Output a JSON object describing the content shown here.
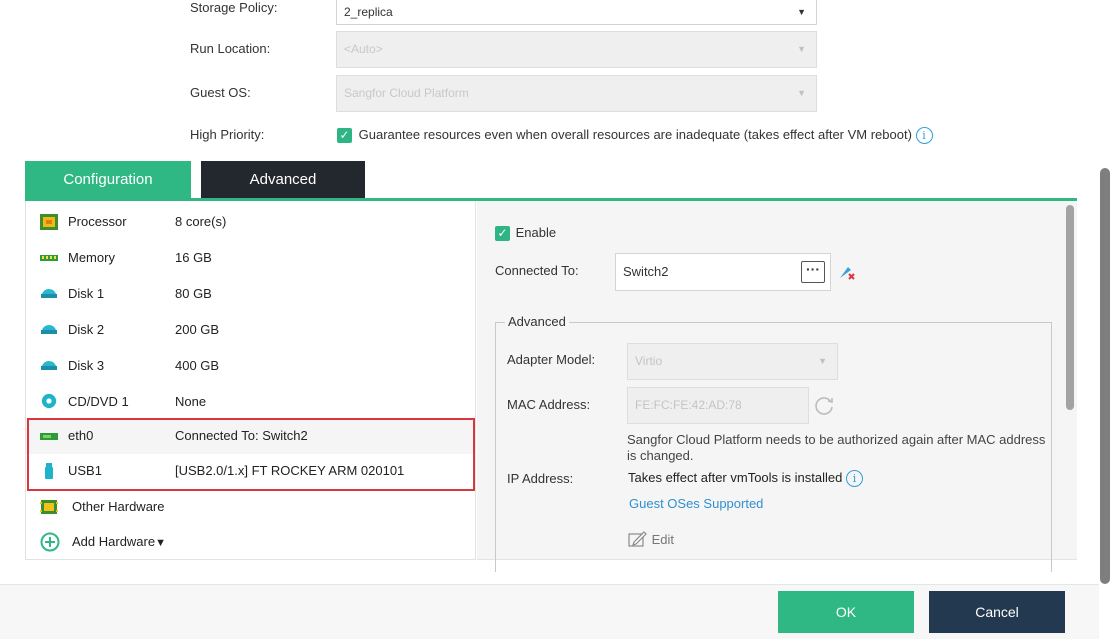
{
  "form": {
    "storage_policy_label": "Storage Policy:",
    "storage_policy_value": "2_replica",
    "run_location_label": "Run Location:",
    "run_location_value": "<Auto>",
    "guest_os_label": "Guest OS:",
    "guest_os_value": "Sangfor Cloud Platform",
    "high_priority_label": "High Priority:",
    "high_priority_text": "Guarantee resources even when overall resources are inadequate (takes effect after VM reboot)",
    "high_priority_checked": true
  },
  "tabs": [
    {
      "label": "Configuration",
      "active": true
    },
    {
      "label": "Advanced",
      "active": false
    }
  ],
  "hardware": [
    {
      "icon": "processor-icon",
      "name": "Processor",
      "value": "8 core(s)"
    },
    {
      "icon": "memory-icon",
      "name": "Memory",
      "value": "16 GB"
    },
    {
      "icon": "disk-icon",
      "name": "Disk 1",
      "value": "80 GB"
    },
    {
      "icon": "disk-icon",
      "name": "Disk 2",
      "value": "200 GB"
    },
    {
      "icon": "disk-icon",
      "name": "Disk 3",
      "value": "400 GB"
    },
    {
      "icon": "cdrom-icon",
      "name": "CD/DVD 1",
      "value": "None"
    },
    {
      "icon": "network-adapter-icon",
      "name": "eth0",
      "value": "Connected To: Switch2"
    },
    {
      "icon": "usb-icon",
      "name": "USB1",
      "value": "[USB2.0/1.x] FT ROCKEY ARM 020101"
    }
  ],
  "other_hardware_label": "Other Hardware",
  "add_hardware_label": "Add Hardware",
  "nic": {
    "enable_label": "Enable",
    "enable_checked": true,
    "connected_to_label": "Connected To:",
    "connected_to_value": "Switch2",
    "advanced_legend": "Advanced",
    "adapter_model_label": "Adapter Model:",
    "adapter_model_value": "Virtio",
    "mac_label": "MAC Address:",
    "mac_value": "FE:FC:FE:42:AD:78",
    "mac_note": "Sangfor Cloud Platform needs to be authorized again after MAC address is changed.",
    "ip_label": "IP Address:",
    "ip_note": "Takes effect after vmTools is installed",
    "guest_os_link": "Guest OSes Supported",
    "edit_label": "Edit"
  },
  "footer": {
    "ok_label": "OK",
    "cancel_label": "Cancel"
  },
  "colors": {
    "accent_green": "#2fb883",
    "dark_tab": "#23272e",
    "cancel_button": "#23394f",
    "highlight_red": "#d9363e",
    "link_blue": "#2f8fd0"
  }
}
